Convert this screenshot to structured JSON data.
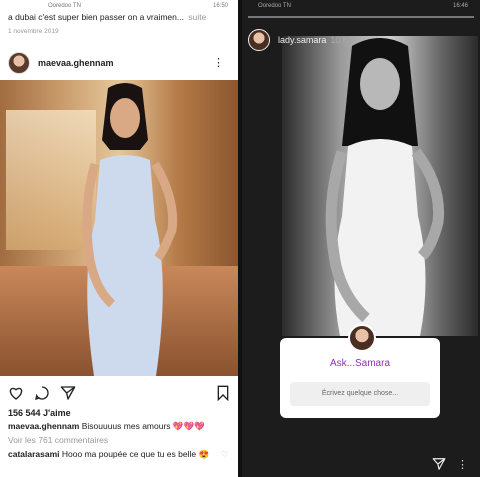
{
  "left": {
    "status": {
      "carrier": "Ooredoo TN",
      "icons": "⚡ ᵂ⁴",
      "time": "16:50"
    },
    "caption_top": "a dubai c'est super bien passer on a vraimen...",
    "caption_more": "suite",
    "date": "1 novembre 2019",
    "post_username": "maevaa.ghennam",
    "likes": "156 544 J'aime",
    "comment1_user": "maevaa.ghennam",
    "comment1_text": "Bisouuuus mes amours",
    "comment1_emoji": "💖💖💖",
    "view_all": "Voir les 761 commentaires",
    "comment2_user": "catalarasami",
    "comment2_text": "Hooo ma poupée ce que tu es belle",
    "comment2_emoji": "😍",
    "icons": [
      "heart-icon",
      "comment-icon",
      "share-icon",
      "bookmark-icon"
    ]
  },
  "right": {
    "status": {
      "carrier": "Ooredoo TN",
      "time": "16:46"
    },
    "username": "lady.samara",
    "time_ago": "10 h",
    "ask_title": "Ask...Samara",
    "ask_placeholder": "Écrivez quelque chose...",
    "icons": [
      "send-icon",
      "more-icon"
    ]
  },
  "colors": {
    "accent_purple": "#8e2fb6",
    "heart_red": "#e0245e"
  }
}
